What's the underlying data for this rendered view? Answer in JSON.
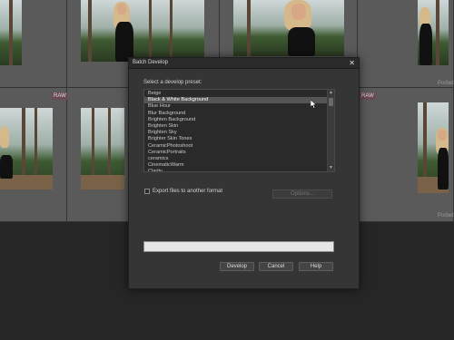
{
  "dialog": {
    "title": "Batch Develop",
    "prompt": "Select a develop preset:",
    "presets": [
      "Beige",
      "Black & White Background",
      "Blue Hour",
      "Blur Background",
      "Brighten Background",
      "Brighten Skin",
      "Brighten Sky",
      "Brighter Skin Tones",
      "CeramicPhotoshoot",
      "CeramicPortraits",
      "ceramics",
      "CinematicWarm",
      "Clarity"
    ],
    "selected_preset": "Black & White Background",
    "export_checkbox": {
      "label": "Export files to another format",
      "checked": false
    },
    "options_button": "Options...",
    "develop_button": "Develop",
    "cancel_button": "Cancel",
    "help_button": "Help",
    "progress": 0
  },
  "grid": {
    "badges": [
      "RAW",
      "RAW"
    ],
    "captions": [
      "Porbet",
      "Porbet"
    ]
  },
  "colors": {
    "dialog_bg": "#353535",
    "selection": "#555555",
    "progress_bg": "#e6e6e6"
  }
}
